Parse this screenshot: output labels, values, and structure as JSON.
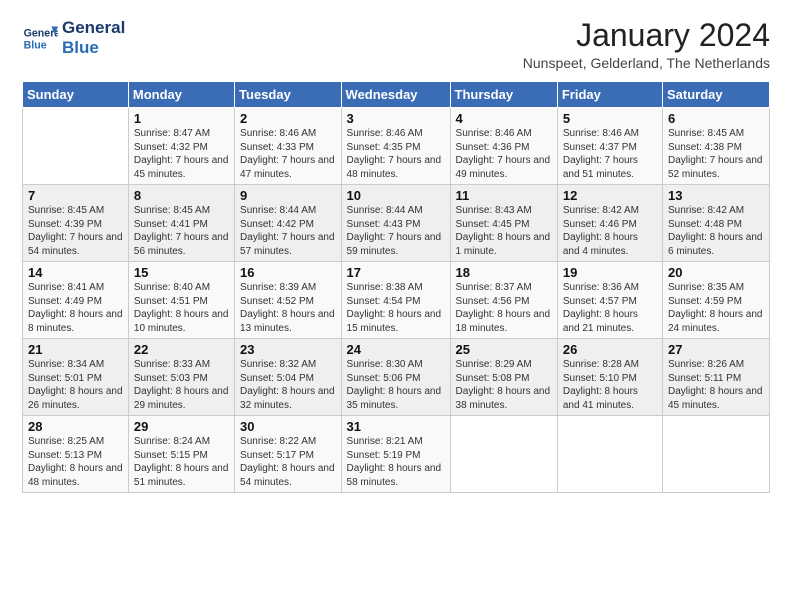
{
  "logo": {
    "line1": "General",
    "line2": "Blue"
  },
  "title": "January 2024",
  "subtitle": "Nunspeet, Gelderland, The Netherlands",
  "days_of_week": [
    "Sunday",
    "Monday",
    "Tuesday",
    "Wednesday",
    "Thursday",
    "Friday",
    "Saturday"
  ],
  "weeks": [
    [
      {
        "day": "",
        "sunrise": "",
        "sunset": "",
        "daylight": ""
      },
      {
        "day": "1",
        "sunrise": "Sunrise: 8:47 AM",
        "sunset": "Sunset: 4:32 PM",
        "daylight": "Daylight: 7 hours and 45 minutes."
      },
      {
        "day": "2",
        "sunrise": "Sunrise: 8:46 AM",
        "sunset": "Sunset: 4:33 PM",
        "daylight": "Daylight: 7 hours and 47 minutes."
      },
      {
        "day": "3",
        "sunrise": "Sunrise: 8:46 AM",
        "sunset": "Sunset: 4:35 PM",
        "daylight": "Daylight: 7 hours and 48 minutes."
      },
      {
        "day": "4",
        "sunrise": "Sunrise: 8:46 AM",
        "sunset": "Sunset: 4:36 PM",
        "daylight": "Daylight: 7 hours and 49 minutes."
      },
      {
        "day": "5",
        "sunrise": "Sunrise: 8:46 AM",
        "sunset": "Sunset: 4:37 PM",
        "daylight": "Daylight: 7 hours and 51 minutes."
      },
      {
        "day": "6",
        "sunrise": "Sunrise: 8:45 AM",
        "sunset": "Sunset: 4:38 PM",
        "daylight": "Daylight: 7 hours and 52 minutes."
      }
    ],
    [
      {
        "day": "7",
        "sunrise": "Sunrise: 8:45 AM",
        "sunset": "Sunset: 4:39 PM",
        "daylight": "Daylight: 7 hours and 54 minutes."
      },
      {
        "day": "8",
        "sunrise": "Sunrise: 8:45 AM",
        "sunset": "Sunset: 4:41 PM",
        "daylight": "Daylight: 7 hours and 56 minutes."
      },
      {
        "day": "9",
        "sunrise": "Sunrise: 8:44 AM",
        "sunset": "Sunset: 4:42 PM",
        "daylight": "Daylight: 7 hours and 57 minutes."
      },
      {
        "day": "10",
        "sunrise": "Sunrise: 8:44 AM",
        "sunset": "Sunset: 4:43 PM",
        "daylight": "Daylight: 7 hours and 59 minutes."
      },
      {
        "day": "11",
        "sunrise": "Sunrise: 8:43 AM",
        "sunset": "Sunset: 4:45 PM",
        "daylight": "Daylight: 8 hours and 1 minute."
      },
      {
        "day": "12",
        "sunrise": "Sunrise: 8:42 AM",
        "sunset": "Sunset: 4:46 PM",
        "daylight": "Daylight: 8 hours and 4 minutes."
      },
      {
        "day": "13",
        "sunrise": "Sunrise: 8:42 AM",
        "sunset": "Sunset: 4:48 PM",
        "daylight": "Daylight: 8 hours and 6 minutes."
      }
    ],
    [
      {
        "day": "14",
        "sunrise": "Sunrise: 8:41 AM",
        "sunset": "Sunset: 4:49 PM",
        "daylight": "Daylight: 8 hours and 8 minutes."
      },
      {
        "day": "15",
        "sunrise": "Sunrise: 8:40 AM",
        "sunset": "Sunset: 4:51 PM",
        "daylight": "Daylight: 8 hours and 10 minutes."
      },
      {
        "day": "16",
        "sunrise": "Sunrise: 8:39 AM",
        "sunset": "Sunset: 4:52 PM",
        "daylight": "Daylight: 8 hours and 13 minutes."
      },
      {
        "day": "17",
        "sunrise": "Sunrise: 8:38 AM",
        "sunset": "Sunset: 4:54 PM",
        "daylight": "Daylight: 8 hours and 15 minutes."
      },
      {
        "day": "18",
        "sunrise": "Sunrise: 8:37 AM",
        "sunset": "Sunset: 4:56 PM",
        "daylight": "Daylight: 8 hours and 18 minutes."
      },
      {
        "day": "19",
        "sunrise": "Sunrise: 8:36 AM",
        "sunset": "Sunset: 4:57 PM",
        "daylight": "Daylight: 8 hours and 21 minutes."
      },
      {
        "day": "20",
        "sunrise": "Sunrise: 8:35 AM",
        "sunset": "Sunset: 4:59 PM",
        "daylight": "Daylight: 8 hours and 24 minutes."
      }
    ],
    [
      {
        "day": "21",
        "sunrise": "Sunrise: 8:34 AM",
        "sunset": "Sunset: 5:01 PM",
        "daylight": "Daylight: 8 hours and 26 minutes."
      },
      {
        "day": "22",
        "sunrise": "Sunrise: 8:33 AM",
        "sunset": "Sunset: 5:03 PM",
        "daylight": "Daylight: 8 hours and 29 minutes."
      },
      {
        "day": "23",
        "sunrise": "Sunrise: 8:32 AM",
        "sunset": "Sunset: 5:04 PM",
        "daylight": "Daylight: 8 hours and 32 minutes."
      },
      {
        "day": "24",
        "sunrise": "Sunrise: 8:30 AM",
        "sunset": "Sunset: 5:06 PM",
        "daylight": "Daylight: 8 hours and 35 minutes."
      },
      {
        "day": "25",
        "sunrise": "Sunrise: 8:29 AM",
        "sunset": "Sunset: 5:08 PM",
        "daylight": "Daylight: 8 hours and 38 minutes."
      },
      {
        "day": "26",
        "sunrise": "Sunrise: 8:28 AM",
        "sunset": "Sunset: 5:10 PM",
        "daylight": "Daylight: 8 hours and 41 minutes."
      },
      {
        "day": "27",
        "sunrise": "Sunrise: 8:26 AM",
        "sunset": "Sunset: 5:11 PM",
        "daylight": "Daylight: 8 hours and 45 minutes."
      }
    ],
    [
      {
        "day": "28",
        "sunrise": "Sunrise: 8:25 AM",
        "sunset": "Sunset: 5:13 PM",
        "daylight": "Daylight: 8 hours and 48 minutes."
      },
      {
        "day": "29",
        "sunrise": "Sunrise: 8:24 AM",
        "sunset": "Sunset: 5:15 PM",
        "daylight": "Daylight: 8 hours and 51 minutes."
      },
      {
        "day": "30",
        "sunrise": "Sunrise: 8:22 AM",
        "sunset": "Sunset: 5:17 PM",
        "daylight": "Daylight: 8 hours and 54 minutes."
      },
      {
        "day": "31",
        "sunrise": "Sunrise: 8:21 AM",
        "sunset": "Sunset: 5:19 PM",
        "daylight": "Daylight: 8 hours and 58 minutes."
      },
      {
        "day": "",
        "sunrise": "",
        "sunset": "",
        "daylight": ""
      },
      {
        "day": "",
        "sunrise": "",
        "sunset": "",
        "daylight": ""
      },
      {
        "day": "",
        "sunrise": "",
        "sunset": "",
        "daylight": ""
      }
    ]
  ]
}
